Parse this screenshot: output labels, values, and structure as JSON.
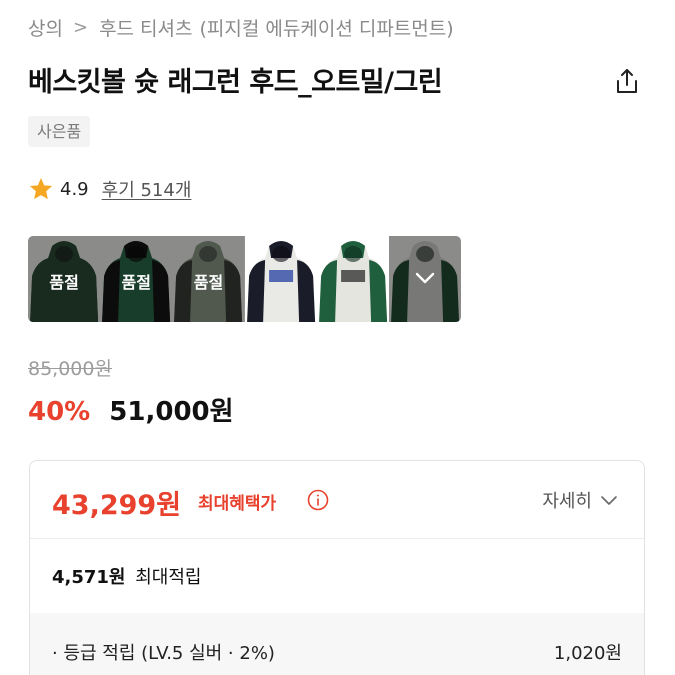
{
  "breadcrumb": {
    "category": "상의",
    "separator": ">",
    "subcategory": "후드 티셔츠",
    "brand": "(피지컬 에듀케이션 디파트먼트)"
  },
  "product": {
    "title": "베스킷볼 슛 래그런 후드_오트밀/그린",
    "gift_tag": "사은품"
  },
  "rating": {
    "score": "4.9",
    "reviews": "후기 514개"
  },
  "swatches": [
    {
      "name": "dark-green",
      "label": "품절",
      "body": "#2c4a36",
      "sleeve": "#2c4a36",
      "soldout": true
    },
    {
      "name": "black-green",
      "label": "품절",
      "body": "#2b6a4b",
      "sleeve": "#151515",
      "soldout": true
    },
    {
      "name": "charcoal-khaki",
      "label": "품절",
      "body": "#8c9a88",
      "sleeve": "#3a3d3a",
      "soldout": true
    },
    {
      "name": "oatmeal-navy",
      "label": "",
      "body": "#e9e9e6",
      "sleeve": "#1a1c2a",
      "soldout": false
    },
    {
      "name": "oatmeal-green",
      "label": "",
      "body": "#e5e5e0",
      "sleeve": "#1f5f3e",
      "soldout": false
    },
    {
      "name": "oatmeal-green-selected",
      "label": "",
      "body": "#cfcfcb",
      "sleeve": "#1f4a33",
      "soldout": false,
      "selected": true
    }
  ],
  "pricing": {
    "original": "85,000원",
    "discount_rate": "40%",
    "sale_price": "51,000원",
    "max_benefit_price": "43,299원",
    "max_benefit_label": "최대혜택가",
    "detail_label": "자세히",
    "points_amount": "4,571원",
    "points_label": "최대적립",
    "grade_label": "· 등급 적립 (LV.5 실버 · 2%)",
    "grade_value": "1,020원"
  },
  "colors": {
    "accent_red": "#e8412d",
    "star": "#f5a623",
    "muted_text": "#8a8a8a"
  }
}
